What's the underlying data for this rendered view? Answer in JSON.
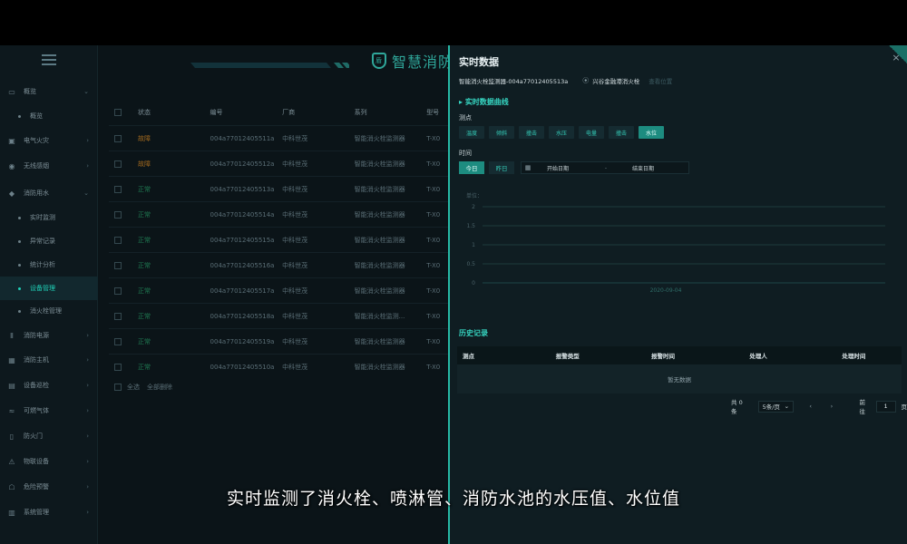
{
  "app": {
    "title": "智慧消防"
  },
  "sidebar": {
    "items": [
      {
        "label": "概览",
        "icon": "monitor-icon",
        "sub": false,
        "active": false,
        "arrow": "⌄"
      },
      {
        "label": "概览",
        "sub": true,
        "active": false
      },
      {
        "label": "电气火灾",
        "icon": "electric-fire-icon",
        "sub": false,
        "active": false,
        "arrow": "›"
      },
      {
        "label": "无线感烟",
        "icon": "smoke-sensor-icon",
        "sub": false,
        "active": false,
        "arrow": "›"
      },
      {
        "label": "消防用水",
        "icon": "water-drop-icon",
        "sub": false,
        "active": false,
        "arrow": "⌄"
      },
      {
        "label": "实时监测",
        "sub": true,
        "active": false
      },
      {
        "label": "异常记录",
        "sub": true,
        "active": false
      },
      {
        "label": "统计分析",
        "sub": true,
        "active": false
      },
      {
        "label": "设备管理",
        "sub": true,
        "active": true
      },
      {
        "label": "消火栓管理",
        "sub": true,
        "active": false
      },
      {
        "label": "消防电源",
        "icon": "power-icon",
        "sub": false,
        "active": false,
        "arrow": "›"
      },
      {
        "label": "消防主机",
        "icon": "host-icon",
        "sub": false,
        "active": false,
        "arrow": "›"
      },
      {
        "label": "设备巡检",
        "icon": "inspection-icon",
        "sub": false,
        "active": false,
        "arrow": "›"
      },
      {
        "label": "可燃气体",
        "icon": "gas-icon",
        "sub": false,
        "active": false,
        "arrow": "›"
      },
      {
        "label": "防火门",
        "icon": "door-icon",
        "sub": false,
        "active": false,
        "arrow": "›"
      },
      {
        "label": "物联设备",
        "icon": "iot-icon",
        "sub": false,
        "active": false,
        "arrow": "›"
      },
      {
        "label": "危险预警",
        "icon": "warning-icon",
        "sub": false,
        "active": false,
        "arrow": "›"
      },
      {
        "label": "系统管理",
        "icon": "settings-icon",
        "sub": false,
        "active": false,
        "arrow": "›"
      }
    ]
  },
  "device_table": {
    "headers": {
      "status": "状态",
      "number": "编号",
      "vendor": "厂商",
      "series": "系列",
      "model": "型号"
    },
    "rows": [
      {
        "status": "故障",
        "kind": "alarm",
        "number": "004a77012405511a",
        "vendor": "中科世茂",
        "series": "智能消火栓监测器",
        "model": "T-X0"
      },
      {
        "status": "故障",
        "kind": "alarm",
        "number": "004a77012405512a",
        "vendor": "中科世茂",
        "series": "智能消火栓监测器",
        "model": "T-X0"
      },
      {
        "status": "正常",
        "kind": "normal",
        "number": "004a77012405513a",
        "vendor": "中科世茂",
        "series": "智能消火栓监测器",
        "model": "T-X0"
      },
      {
        "status": "正常",
        "kind": "normal",
        "number": "004a77012405514a",
        "vendor": "中科世茂",
        "series": "智能消火栓监测器",
        "model": "T-X0"
      },
      {
        "status": "正常",
        "kind": "normal",
        "number": "004a77012405515a",
        "vendor": "中科世茂",
        "series": "智能消火栓监测器",
        "model": "T-X0"
      },
      {
        "status": "正常",
        "kind": "normal",
        "number": "004a77012405516a",
        "vendor": "中科世茂",
        "series": "智能消火栓监测器",
        "model": "T-X0"
      },
      {
        "status": "正常",
        "kind": "normal",
        "number": "004a77012405517a",
        "vendor": "中科世茂",
        "series": "智能消火栓监测器",
        "model": "T-X0"
      },
      {
        "status": "正常",
        "kind": "normal",
        "number": "004a77012405518a",
        "vendor": "中科世茂",
        "series": "智能消火栓监测...",
        "model": "T-X0"
      },
      {
        "status": "正常",
        "kind": "normal",
        "number": "004a77012405519a",
        "vendor": "中科世茂",
        "series": "智能消火栓监测器",
        "model": "T-X0"
      },
      {
        "status": "正常",
        "kind": "normal",
        "number": "004a77012405510a",
        "vendor": "中科世茂",
        "series": "智能消火栓监测器",
        "model": "T-X0"
      }
    ],
    "footer": {
      "select_all": "全选",
      "delete_all": "全部删除"
    }
  },
  "drawer": {
    "title": "实时数据",
    "close": "×",
    "device_name": "智能消火栓监测器-004a77012405513a",
    "location": "兴谷金融港消火栓",
    "location_link": "查看位置",
    "curve_section": "实时数据曲线",
    "measure_label": "测点",
    "measure_points": [
      {
        "label": "温度",
        "active": false
      },
      {
        "label": "倾斜",
        "active": false
      },
      {
        "label": "撞击",
        "active": false
      },
      {
        "label": "水压",
        "active": false
      },
      {
        "label": "电量",
        "active": false
      },
      {
        "label": "撞击",
        "active": false
      },
      {
        "label": "水位",
        "active": true
      }
    ],
    "time_label": "时间",
    "time_buttons": [
      {
        "label": "今日",
        "active": true
      },
      {
        "label": "昨日",
        "active": false
      }
    ],
    "date_start_placeholder": "开始日期",
    "date_sep": "-",
    "date_end_placeholder": "结束日期",
    "history_section": "历史记录",
    "history_headers": [
      "测点",
      "报警类型",
      "报警时间",
      "处理人",
      "处理时间"
    ],
    "history_empty": "暂无数据",
    "pager": {
      "total": "共 0 条",
      "page_size": "5条/页",
      "prev": "‹",
      "next": "›",
      "goto": "前往",
      "page": "1",
      "page_unit": "页"
    }
  },
  "chart_data": {
    "type": "line",
    "title": "",
    "ylabel": "单位：",
    "xlabel": "",
    "categories": [
      "2020-09-04"
    ],
    "series": [],
    "ylim": [
      0,
      2
    ],
    "yticks": [
      "2",
      "1.5",
      "1",
      "0.5",
      "0"
    ],
    "grid": true
  },
  "subtitle": "实时监测了消火栓、喷淋管、消防水池的水压值、水位值",
  "colors": {
    "accent": "#26b8a5",
    "alarm": "#a36a1e",
    "normal": "#1f7a52"
  }
}
